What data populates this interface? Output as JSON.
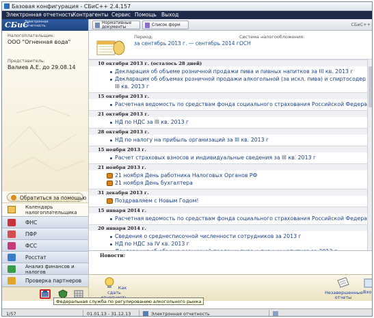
{
  "window": {
    "title": "Базовая конфигурация - СБиС++ 2.4.157"
  },
  "menu": [
    "Электронная отчетность",
    "Контрагенты",
    "Сервис",
    "Помощь",
    "Выход"
  ],
  "brand": {
    "logo": "СБиС",
    "subtitle": "Электронная Отчетность"
  },
  "sidebar": {
    "taxpayer_label": "Налогоплательщик:",
    "taxpayer_value": "ООО \"Огненная вода\"",
    "rep_label": "Представитель:",
    "rep_value": "Валиев А.Е. до 29.08.14",
    "help_button": "Обратиться за помощью",
    "calendar": "Календарь налогоплательщика",
    "nav": [
      "ФНС",
      "ПФР",
      "ФСС",
      "Росстат",
      "Анализ финансов и налогов",
      "Проверка партнеров"
    ]
  },
  "toolbar": {
    "normative": "Нормативные документы",
    "forms": "Список форм",
    "right_label": "СБиС++"
  },
  "header": {
    "period_label": "Период:",
    "period_value": "за сентябрь 2013 г. — сентябрь 2014 г.",
    "tax_label": "Система налогообложения:",
    "tax_value": "ОСН"
  },
  "feed": [
    {
      "date": "10 октября 2013 г. (осталось 28 дней)",
      "items": [
        {
          "text": "Декларация об объеме розничной продажи пива и пивных напитков за III кв. 2013 г",
          "kind": "doc"
        },
        {
          "text": "Декларация об объемах розничной продажи алкогольной (за искл. пива) и спиртосодер",
          "kind": "doc"
        },
        {
          "text": "III кв. 2013 г",
          "kind": "cont"
        }
      ]
    },
    {
      "date": "15 октября 2013 г.",
      "items": [
        {
          "text": "Расчетная ведомость по средствам фонда социального страхования Российской Федера",
          "kind": "doc"
        }
      ]
    },
    {
      "date": "21 октября 2013 г.",
      "items": [
        {
          "text": "НД по НДС за III кв. 2013 г",
          "kind": "doc"
        }
      ]
    },
    {
      "date": "28 октября 2013 г.",
      "items": [
        {
          "text": "НД по налогу на прибыль организаций за III кв. 2013 г",
          "kind": "doc"
        }
      ]
    },
    {
      "date": "15 ноября 2013 г.",
      "items": [
        {
          "text": "Расчет страховых взносов и индивидуальные сведения за III кв. 2013 г",
          "kind": "doc"
        }
      ]
    },
    {
      "date": "21 ноября 2013 г.",
      "items": [
        {
          "text": "21 ноября День работника Налоговых Органов РФ",
          "kind": "event"
        },
        {
          "text": "21 ноября День бухгалтера",
          "kind": "event"
        }
      ]
    },
    {
      "date": "31 декабря 2013 г.",
      "items": [
        {
          "text": "Поздравляем с Новым Годом!",
          "kind": "event"
        }
      ]
    },
    {
      "date": "15 января 2014 г.",
      "items": [
        {
          "text": "Расчетная ведомость по средствам фонда социального страхования Российской Федера",
          "kind": "doc"
        }
      ]
    },
    {
      "date": "20 января 2014 г.",
      "items": [
        {
          "text": "Сведения о среднесписочной численности сотрудников за 2013 г",
          "kind": "doc"
        },
        {
          "text": "НД по НДС за IV кв. 2013 г",
          "kind": "doc"
        },
        {
          "text": "Декларация об объеме розничной продажи пива и пивных напитков за 2013 г",
          "kind": "doc"
        }
      ]
    }
  ],
  "news": {
    "label": "Новости:"
  },
  "bottom": {
    "how_to": "Как сдать отчетность",
    "unfinished": "Незавершенные отчеты",
    "cut": "Вхо"
  },
  "tooltip": "Федеральная служба по регулированию алкогольного рынка",
  "status": {
    "page": "1/57",
    "range": "01.01.13 - 31.12.13",
    "mode": "Электронная отчетность"
  }
}
